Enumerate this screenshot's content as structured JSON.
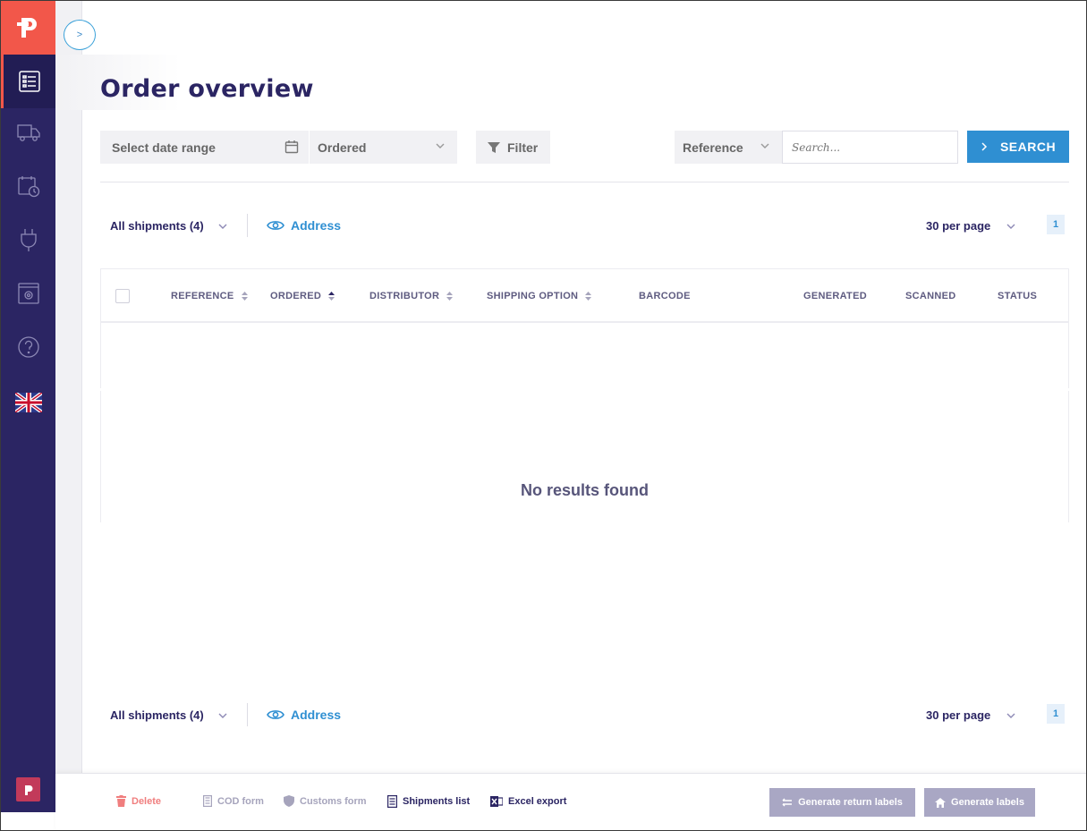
{
  "colors": {
    "sidebar": "#2b2563",
    "brand": "#f2574a",
    "accent": "#2f8fd2",
    "disabled_button": "#a9a7c4"
  },
  "sidebar": {
    "logo_icon": "parcelpro-logo-icon",
    "items": [
      {
        "icon": "order-list-icon",
        "active": true
      },
      {
        "icon": "truck-icon"
      },
      {
        "icon": "calendar-clock-icon"
      },
      {
        "icon": "plug-icon"
      },
      {
        "icon": "settings-window-icon"
      },
      {
        "icon": "help-icon"
      },
      {
        "icon": "uk-flag-icon"
      }
    ]
  },
  "toggle": {
    "label": ">"
  },
  "page": {
    "title": "Order overview"
  },
  "filters": {
    "date_range_placeholder": "Select date range",
    "date_type": "Ordered",
    "filter_label": "Filter",
    "search_field": "Reference",
    "search_placeholder": "Search...",
    "search_button": "SEARCH"
  },
  "toolbar": {
    "shipments": "All shipments (4)",
    "address": "Address",
    "per_page": "30 per page",
    "page": "1"
  },
  "table": {
    "columns": [
      "REFERENCE",
      "ORDERED",
      "DISTRIBUTOR",
      "SHIPPING OPTION",
      "BARCODE",
      "GENERATED",
      "SCANNED",
      "STATUS"
    ],
    "sorted_column": "ORDERED",
    "empty_text": "No results found"
  },
  "footer": {
    "delete": "Delete",
    "cod_form": "COD form",
    "customs_form": "Customs form",
    "shipments_list": "Shipments list",
    "excel_export": "Excel export",
    "generate_return_labels": "Generate return labels",
    "generate_labels": "Generate labels"
  }
}
